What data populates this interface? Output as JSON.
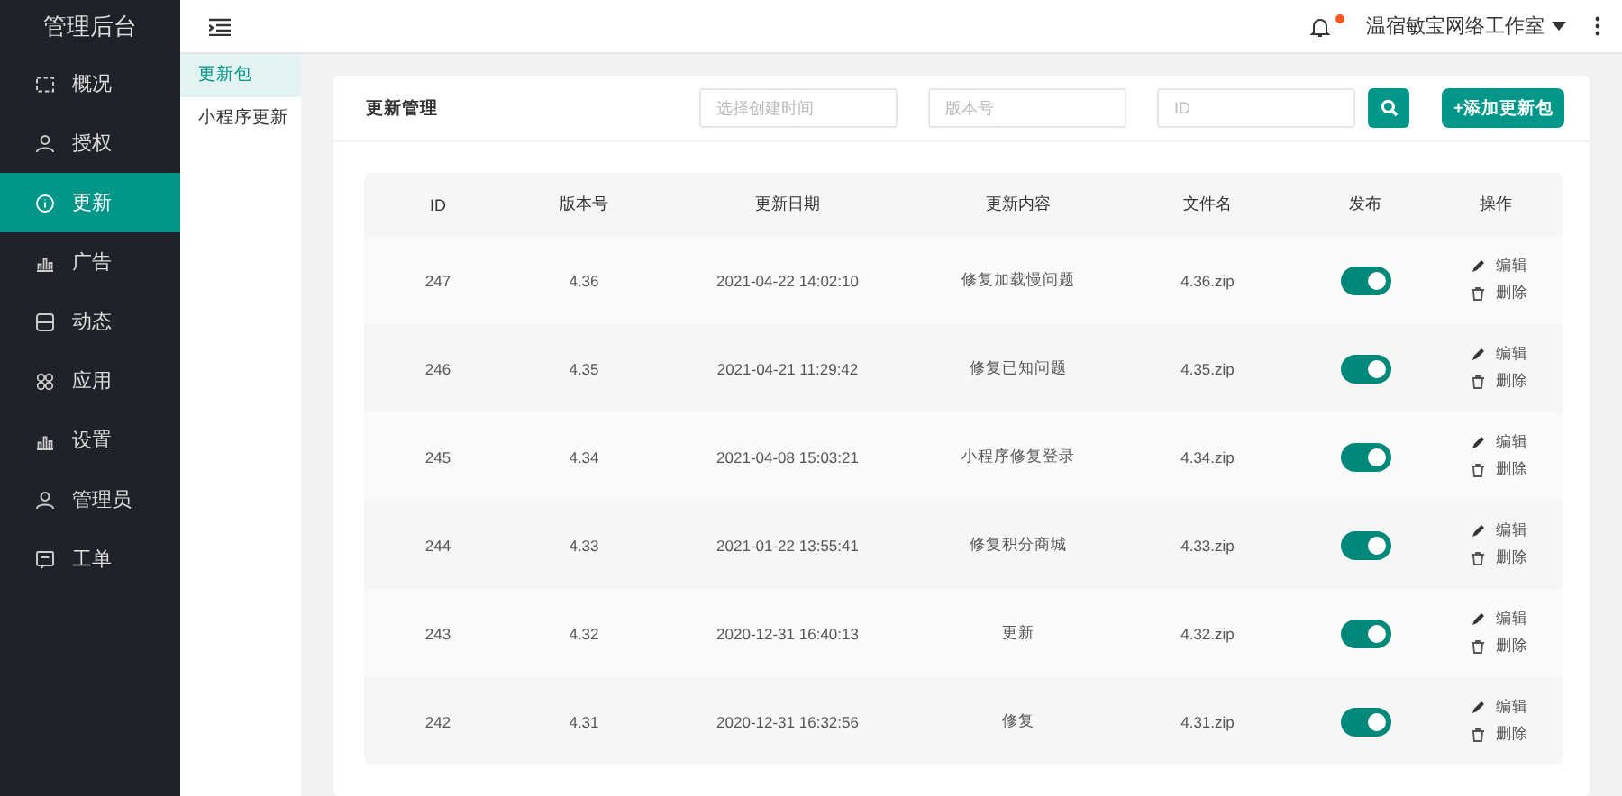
{
  "sidebar": {
    "title": "管理后台",
    "items": [
      {
        "label": "概况",
        "selected": false
      },
      {
        "label": "授权",
        "selected": false
      },
      {
        "label": "更新",
        "selected": true
      },
      {
        "label": "广告",
        "selected": false
      },
      {
        "label": "动态",
        "selected": false
      },
      {
        "label": "应用",
        "selected": false
      },
      {
        "label": "设置",
        "selected": false
      },
      {
        "label": "管理员",
        "selected": false
      },
      {
        "label": "工单",
        "selected": false
      }
    ]
  },
  "topbar": {
    "user": "温宿敏宝网络工作室",
    "has_notification": true
  },
  "subnav": [
    {
      "label": "更新包",
      "selected": true
    },
    {
      "label": "小程序更新",
      "selected": false
    }
  ],
  "card": {
    "title": "更新管理",
    "filters": [
      {
        "placeholder": "选择创建时间"
      },
      {
        "placeholder": "版本号"
      },
      {
        "placeholder": "ID"
      }
    ],
    "add_button": "+添加更新包"
  },
  "table": {
    "columns": [
      "ID",
      "版本号",
      "更新日期",
      "更新内容",
      "文件名",
      "发布",
      "操作"
    ],
    "rows": [
      {
        "id": "247",
        "version": "4.36",
        "date": "2021-04-22 14:02:10",
        "content": "修复加载慢问题",
        "file": "4.36.zip",
        "on": true,
        "edit": "编辑",
        "delete": "删除"
      },
      {
        "id": "246",
        "version": "4.35",
        "date": "2021-04-21 11:29:42",
        "content": "修复已知问题",
        "file": "4.35.zip",
        "on": true,
        "edit": "编辑",
        "delete": "删除"
      },
      {
        "id": "245",
        "version": "4.34",
        "date": "2021-04-08 15:03:21",
        "content": "小程序修复登录",
        "file": "4.34.zip",
        "on": true,
        "edit": "编辑",
        "delete": "删除"
      },
      {
        "id": "244",
        "version": "4.33",
        "date": "2021-01-22 13:55:41",
        "content": "修复积分商城",
        "file": "4.33.zip",
        "on": true,
        "edit": "编辑",
        "delete": "删除"
      },
      {
        "id": "243",
        "version": "4.32",
        "date": "2020-12-31 16:40:13",
        "content": "更新",
        "file": "4.32.zip",
        "on": true,
        "edit": "编辑",
        "delete": "删除"
      },
      {
        "id": "242",
        "version": "4.31",
        "date": "2020-12-31 16:32:56",
        "content": "修复",
        "file": "4.31.zip",
        "on": true,
        "edit": "编辑",
        "delete": "删除"
      }
    ]
  }
}
